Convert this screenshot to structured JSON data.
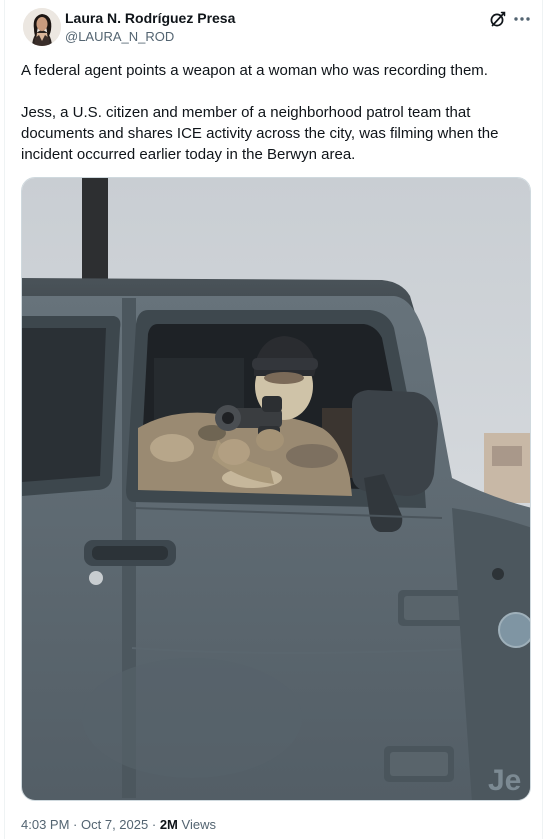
{
  "author": {
    "display_name": "Laura N. Rodríguez Presa",
    "handle": "@LAURA_N_ROD"
  },
  "tweet": {
    "paragraph_1": "A federal agent points a weapon at a woman who was recording them.",
    "paragraph_2": "Jess, a U.S. citizen and member of a neighborhood patrol team that documents and shares ICE activity across the city, was filming when the incident occurred earlier today in the Berwyn area."
  },
  "media": {
    "vehicle_badge_text": "Je"
  },
  "meta": {
    "time": "4:03 PM",
    "separator": "·",
    "date": "Oct 7, 2025",
    "views_count": "2M",
    "views_label": "Views"
  },
  "icons": {
    "grok": "grok-icon",
    "more": "more-options-icon"
  },
  "colors": {
    "text_primary": "#0f1419",
    "text_secondary": "#536471",
    "vehicle_gray": "#5f6b73"
  }
}
